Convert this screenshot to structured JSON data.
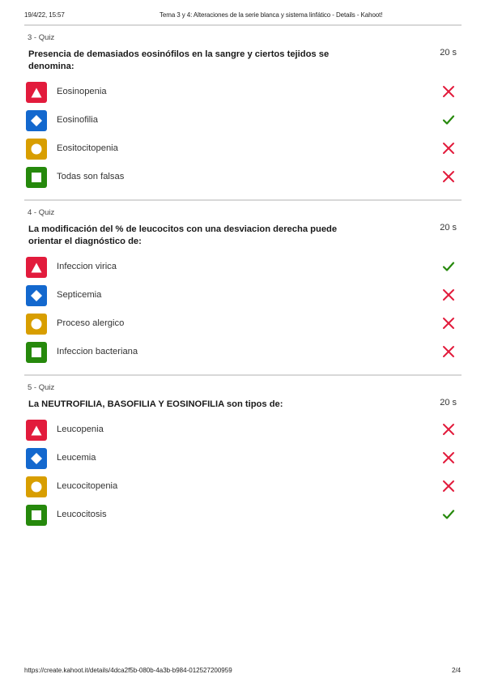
{
  "header": {
    "datetime": "19/4/22, 15:57",
    "title": "Tema 3 y 4: Alteraciones de la serie blanca y sistema linfático - Details - Kahoot!"
  },
  "footer": {
    "url": "https://create.kahoot.it/details/4dca2f5b-080b-4a3b-b984-012527200959",
    "page": "2/4"
  },
  "colors": {
    "triangle": "#e21b3c",
    "diamond": "#1368ce",
    "circle": "#d89e00",
    "square": "#26890c",
    "wrong": "#e21b3c",
    "correct": "#26890c"
  },
  "quizzes": [
    {
      "label": "3 - Quiz",
      "question": "Presencia de demasiados eosinófilos en la sangre y ciertos tejidos se denomina:",
      "time": "20 s",
      "answers": [
        {
          "shape": "triangle-icon",
          "text": "Eosinopenia",
          "result": "cross-icon"
        },
        {
          "shape": "diamond-icon",
          "text": "Eosinofilia",
          "result": "check-icon"
        },
        {
          "shape": "circle-icon",
          "text": "Eositocitopenia",
          "result": "cross-icon"
        },
        {
          "shape": "square-icon",
          "text": "Todas son falsas",
          "result": "cross-icon"
        }
      ]
    },
    {
      "label": "4 - Quiz",
      "question": "La modificación del % de leucocitos con una desviacion derecha puede orientar el diagnóstico de:",
      "time": "20 s",
      "answers": [
        {
          "shape": "triangle-icon",
          "text": "Infeccion virica",
          "result": "check-icon"
        },
        {
          "shape": "diamond-icon",
          "text": "Septicemia",
          "result": "cross-icon"
        },
        {
          "shape": "circle-icon",
          "text": "Proceso alergico",
          "result": "cross-icon"
        },
        {
          "shape": "square-icon",
          "text": "Infeccion bacteriana",
          "result": "cross-icon"
        }
      ]
    },
    {
      "label": "5 - Quiz",
      "question": "La NEUTROFILIA, BASOFILIA Y EOSINOFILIA son tipos de:",
      "time": "20 s",
      "answers": [
        {
          "shape": "triangle-icon",
          "text": "Leucopenia",
          "result": "cross-icon"
        },
        {
          "shape": "diamond-icon",
          "text": "Leucemia",
          "result": "cross-icon"
        },
        {
          "shape": "circle-icon",
          "text": "Leucocitopenia",
          "result": "cross-icon"
        },
        {
          "shape": "square-icon",
          "text": "Leucocitosis",
          "result": "check-icon"
        }
      ]
    }
  ]
}
